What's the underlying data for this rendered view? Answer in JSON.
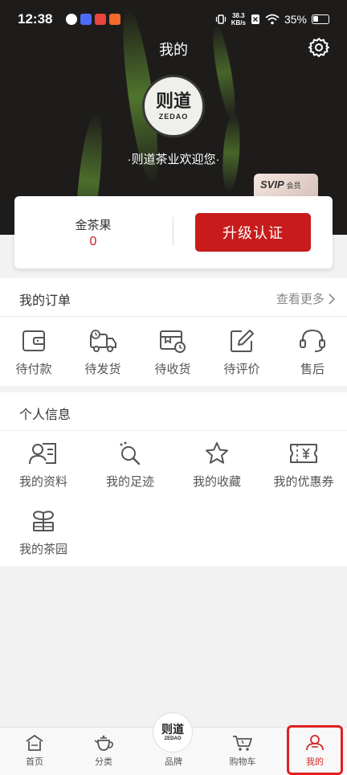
{
  "status_bar": {
    "time": "12:38",
    "net_speed_value": "38.3",
    "net_speed_unit": "KB/s",
    "battery": "35%"
  },
  "header": {
    "title": "我的",
    "logo_text_cn": "则道",
    "logo_text_en": "ZEDAO",
    "welcome": "·则道茶业欢迎您·",
    "svip_label": "SVIP",
    "svip_sub": "会员"
  },
  "card": {
    "label": "金茶果",
    "value": "0",
    "upgrade_button": "升级认证"
  },
  "orders": {
    "title": "我的订单",
    "more": "查看更多",
    "items": [
      {
        "label": "待付款",
        "icon": "wallet-icon"
      },
      {
        "label": "待发货",
        "icon": "delivery-truck-icon"
      },
      {
        "label": "待收货",
        "icon": "receive-box-icon"
      },
      {
        "label": "待评价",
        "icon": "review-pen-icon"
      },
      {
        "label": "售后",
        "icon": "headset-icon"
      }
    ]
  },
  "personal": {
    "title": "个人信息",
    "items": [
      {
        "label": "我的资料",
        "icon": "profile-card-icon"
      },
      {
        "label": "我的足迹",
        "icon": "footprint-icon"
      },
      {
        "label": "我的收藏",
        "icon": "star-icon"
      },
      {
        "label": "我的优惠券",
        "icon": "coupon-icon"
      },
      {
        "label": "我的茶园",
        "icon": "tea-garden-icon"
      }
    ]
  },
  "bottom_nav": {
    "items": [
      {
        "label": "首页",
        "icon": "home-icon"
      },
      {
        "label": "分类",
        "icon": "teapot-icon"
      },
      {
        "label": "品牌",
        "icon": "brand-logo-icon"
      },
      {
        "label": "购物车",
        "icon": "cart-icon"
      },
      {
        "label": "我的",
        "icon": "profile-icon"
      }
    ],
    "brand_cn": "则道",
    "brand_en": "ZEDAO",
    "active_index": 4
  },
  "colors": {
    "accent": "#c81c1c",
    "header_bg": "#1e1c1b",
    "page_bg": "#f2f2f2"
  }
}
